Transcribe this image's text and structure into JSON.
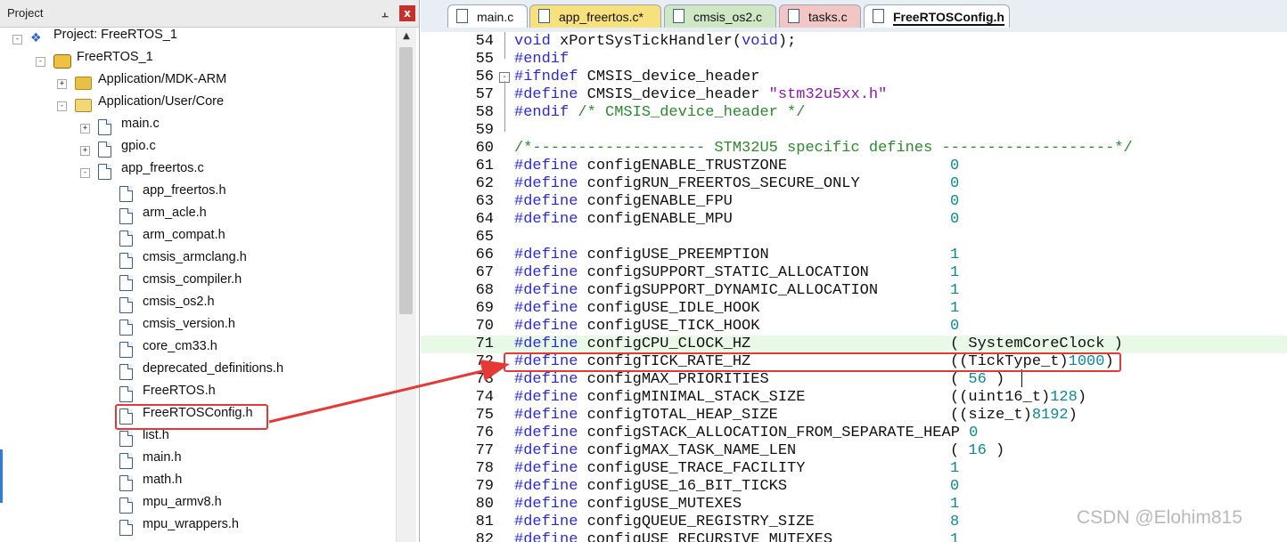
{
  "project_panel": {
    "title": "Project",
    "pin_icon": "pin-icon",
    "close_label": "x",
    "tree": [
      {
        "label": "Project: FreeRTOS_1",
        "indent": 0,
        "toggle": "-",
        "icon": "project-icon"
      },
      {
        "label": "FreeRTOS_1",
        "indent": 1,
        "toggle": "-",
        "icon": "target-icon"
      },
      {
        "label": "Application/MDK-ARM",
        "indent": 2,
        "toggle": "+",
        "icon": "folder-icon"
      },
      {
        "label": "Application/User/Core",
        "indent": 2,
        "toggle": "-",
        "icon": "folder-open-icon"
      },
      {
        "label": "main.c",
        "indent": 3,
        "toggle": "+",
        "icon": "file-icon"
      },
      {
        "label": "gpio.c",
        "indent": 3,
        "toggle": "+",
        "icon": "file-icon"
      },
      {
        "label": "app_freertos.c",
        "indent": 3,
        "toggle": "-",
        "icon": "file-icon"
      },
      {
        "label": "app_freertos.h",
        "indent": 4,
        "toggle": "",
        "icon": "file-icon"
      },
      {
        "label": "arm_acle.h",
        "indent": 4,
        "toggle": "",
        "icon": "file-icon"
      },
      {
        "label": "arm_compat.h",
        "indent": 4,
        "toggle": "",
        "icon": "file-icon"
      },
      {
        "label": "cmsis_armclang.h",
        "indent": 4,
        "toggle": "",
        "icon": "file-icon"
      },
      {
        "label": "cmsis_compiler.h",
        "indent": 4,
        "toggle": "",
        "icon": "file-icon"
      },
      {
        "label": "cmsis_os2.h",
        "indent": 4,
        "toggle": "",
        "icon": "file-icon"
      },
      {
        "label": "cmsis_version.h",
        "indent": 4,
        "toggle": "",
        "icon": "file-icon"
      },
      {
        "label": "core_cm33.h",
        "indent": 4,
        "toggle": "",
        "icon": "file-icon"
      },
      {
        "label": "deprecated_definitions.h",
        "indent": 4,
        "toggle": "",
        "icon": "file-icon"
      },
      {
        "label": "FreeRTOS.h",
        "indent": 4,
        "toggle": "",
        "icon": "file-icon"
      },
      {
        "label": "FreeRTOSConfig.h",
        "indent": 4,
        "toggle": "",
        "icon": "file-icon"
      },
      {
        "label": "list.h",
        "indent": 4,
        "toggle": "",
        "icon": "file-icon"
      },
      {
        "label": "main.h",
        "indent": 4,
        "toggle": "",
        "icon": "file-icon"
      },
      {
        "label": "math.h",
        "indent": 4,
        "toggle": "",
        "icon": "file-icon"
      },
      {
        "label": "mpu_armv8.h",
        "indent": 4,
        "toggle": "",
        "icon": "file-icon"
      },
      {
        "label": "mpu_wrappers.h",
        "indent": 4,
        "toggle": "",
        "icon": "file-icon"
      }
    ]
  },
  "editor": {
    "tabs": [
      {
        "label": "main.c",
        "color": "#ffffff",
        "active": false
      },
      {
        "label": "app_freertos.c*",
        "color": "#f7e17d",
        "active": false
      },
      {
        "label": "cmsis_os2.c",
        "color": "#cfe7c5",
        "active": false
      },
      {
        "label": "tasks.c",
        "color": "#f3c6c6",
        "active": false
      },
      {
        "label": "FreeRTOSConfig.h",
        "color": "#ffffff",
        "active": true
      }
    ],
    "lines": [
      {
        "n": "54",
        "code": [
          [
            "kw",
            "void"
          ],
          [
            "t",
            " xPortSysTickHandler("
          ],
          [
            "kw",
            "void"
          ],
          [
            "t",
            ");"
          ]
        ],
        "val": []
      },
      {
        "n": "55",
        "code": [
          [
            "pre",
            "#endif"
          ]
        ],
        "val": []
      },
      {
        "n": "56",
        "code": [
          [
            "pre",
            "#ifndef"
          ],
          [
            "t",
            " CMSIS_device_header"
          ]
        ],
        "val": [],
        "fold": "-"
      },
      {
        "n": "57",
        "code": [
          [
            "pre",
            "#define"
          ],
          [
            "t",
            " CMSIS_device_header "
          ],
          [
            "str",
            "\"stm32u5xx.h\""
          ]
        ],
        "val": []
      },
      {
        "n": "58",
        "code": [
          [
            "pre",
            "#endif"
          ],
          [
            "cmt",
            " /* CMSIS_device_header */"
          ]
        ],
        "val": []
      },
      {
        "n": "59",
        "code": [],
        "val": []
      },
      {
        "n": "60",
        "code": [
          [
            "cmt",
            "/*------------------- STM32U5 specific defines -------------------*/"
          ]
        ],
        "val": []
      },
      {
        "n": "61",
        "code": [
          [
            "pre",
            "#define"
          ],
          [
            "t",
            " configENABLE_TRUSTZONE"
          ]
        ],
        "val": [
          [
            "num",
            "0"
          ]
        ]
      },
      {
        "n": "62",
        "code": [
          [
            "pre",
            "#define"
          ],
          [
            "t",
            " configRUN_FREERTOS_SECURE_ONLY"
          ]
        ],
        "val": [
          [
            "num",
            "0"
          ]
        ]
      },
      {
        "n": "63",
        "code": [
          [
            "pre",
            "#define"
          ],
          [
            "t",
            " configENABLE_FPU"
          ]
        ],
        "val": [
          [
            "num",
            "0"
          ]
        ]
      },
      {
        "n": "64",
        "code": [
          [
            "pre",
            "#define"
          ],
          [
            "t",
            " configENABLE_MPU"
          ]
        ],
        "val": [
          [
            "num",
            "0"
          ]
        ]
      },
      {
        "n": "65",
        "code": [],
        "val": []
      },
      {
        "n": "66",
        "code": [
          [
            "pre",
            "#define"
          ],
          [
            "t",
            " configUSE_PREEMPTION"
          ]
        ],
        "val": [
          [
            "num",
            "1"
          ]
        ]
      },
      {
        "n": "67",
        "code": [
          [
            "pre",
            "#define"
          ],
          [
            "t",
            " configSUPPORT_STATIC_ALLOCATION"
          ]
        ],
        "val": [
          [
            "num",
            "1"
          ]
        ]
      },
      {
        "n": "68",
        "code": [
          [
            "pre",
            "#define"
          ],
          [
            "t",
            " configSUPPORT_DYNAMIC_ALLOCATION"
          ]
        ],
        "val": [
          [
            "num",
            "1"
          ]
        ]
      },
      {
        "n": "69",
        "code": [
          [
            "pre",
            "#define"
          ],
          [
            "t",
            " configUSE_IDLE_HOOK"
          ]
        ],
        "val": [
          [
            "num",
            "1"
          ]
        ]
      },
      {
        "n": "70",
        "code": [
          [
            "pre",
            "#define"
          ],
          [
            "t",
            " configUSE_TICK_HOOK"
          ]
        ],
        "val": [
          [
            "num",
            "0"
          ]
        ]
      },
      {
        "n": "71",
        "code": [
          [
            "pre",
            "#define"
          ],
          [
            "t",
            " configCPU_CLOCK_HZ"
          ]
        ],
        "val": [
          [
            "t",
            "( SystemCoreClock )"
          ]
        ],
        "highlight": true
      },
      {
        "n": "72",
        "code": [
          [
            "pre",
            "#define"
          ],
          [
            "t",
            " configTICK_RATE_HZ"
          ]
        ],
        "val": [
          [
            "t",
            "((TickType_t)"
          ],
          [
            "num",
            "1000"
          ],
          [
            "t",
            ")"
          ]
        ]
      },
      {
        "n": "73",
        "code": [
          [
            "pre",
            "#define"
          ],
          [
            "t",
            " configMAX_PRIORITIES"
          ]
        ],
        "val": [
          [
            "t",
            "( "
          ],
          [
            "num",
            "56"
          ],
          [
            "t",
            " )"
          ]
        ]
      },
      {
        "n": "74",
        "code": [
          [
            "pre",
            "#define"
          ],
          [
            "t",
            " configMINIMAL_STACK_SIZE"
          ]
        ],
        "val": [
          [
            "t",
            "((uint16_t)"
          ],
          [
            "num",
            "128"
          ],
          [
            "t",
            ")"
          ]
        ]
      },
      {
        "n": "75",
        "code": [
          [
            "pre",
            "#define"
          ],
          [
            "t",
            " configTOTAL_HEAP_SIZE"
          ]
        ],
        "val": [
          [
            "t",
            "((size_t)"
          ],
          [
            "num",
            "8192"
          ],
          [
            "t",
            ")"
          ]
        ]
      },
      {
        "n": "76",
        "code": [
          [
            "pre",
            "#define"
          ],
          [
            "t",
            " configSTACK_ALLOCATION_FROM_SEPARATE_HEAP "
          ],
          [
            "num",
            "0"
          ]
        ],
        "val": []
      },
      {
        "n": "77",
        "code": [
          [
            "pre",
            "#define"
          ],
          [
            "t",
            " configMAX_TASK_NAME_LEN"
          ]
        ],
        "val": [
          [
            "t",
            "( "
          ],
          [
            "num",
            "16"
          ],
          [
            "t",
            " )"
          ]
        ]
      },
      {
        "n": "78",
        "code": [
          [
            "pre",
            "#define"
          ],
          [
            "t",
            " configUSE_TRACE_FACILITY"
          ]
        ],
        "val": [
          [
            "num",
            "1"
          ]
        ]
      },
      {
        "n": "79",
        "code": [
          [
            "pre",
            "#define"
          ],
          [
            "t",
            " configUSE_16_BIT_TICKS"
          ]
        ],
        "val": [
          [
            "num",
            "0"
          ]
        ]
      },
      {
        "n": "80",
        "code": [
          [
            "pre",
            "#define"
          ],
          [
            "t",
            " configUSE_MUTEXES"
          ]
        ],
        "val": [
          [
            "num",
            "1"
          ]
        ]
      },
      {
        "n": "81",
        "code": [
          [
            "pre",
            "#define"
          ],
          [
            "t",
            " configQUEUE_REGISTRY_SIZE"
          ]
        ],
        "val": [
          [
            "num",
            "8"
          ]
        ]
      },
      {
        "n": "82",
        "code": [
          [
            "pre",
            "#define"
          ],
          [
            "t",
            " configUSE_RECURSIVE_MUTEXES"
          ]
        ],
        "val": [
          [
            "num",
            "1"
          ]
        ]
      }
    ]
  },
  "annotation": {
    "color": "#e53935"
  },
  "watermark": "CSDN @Elohim815"
}
